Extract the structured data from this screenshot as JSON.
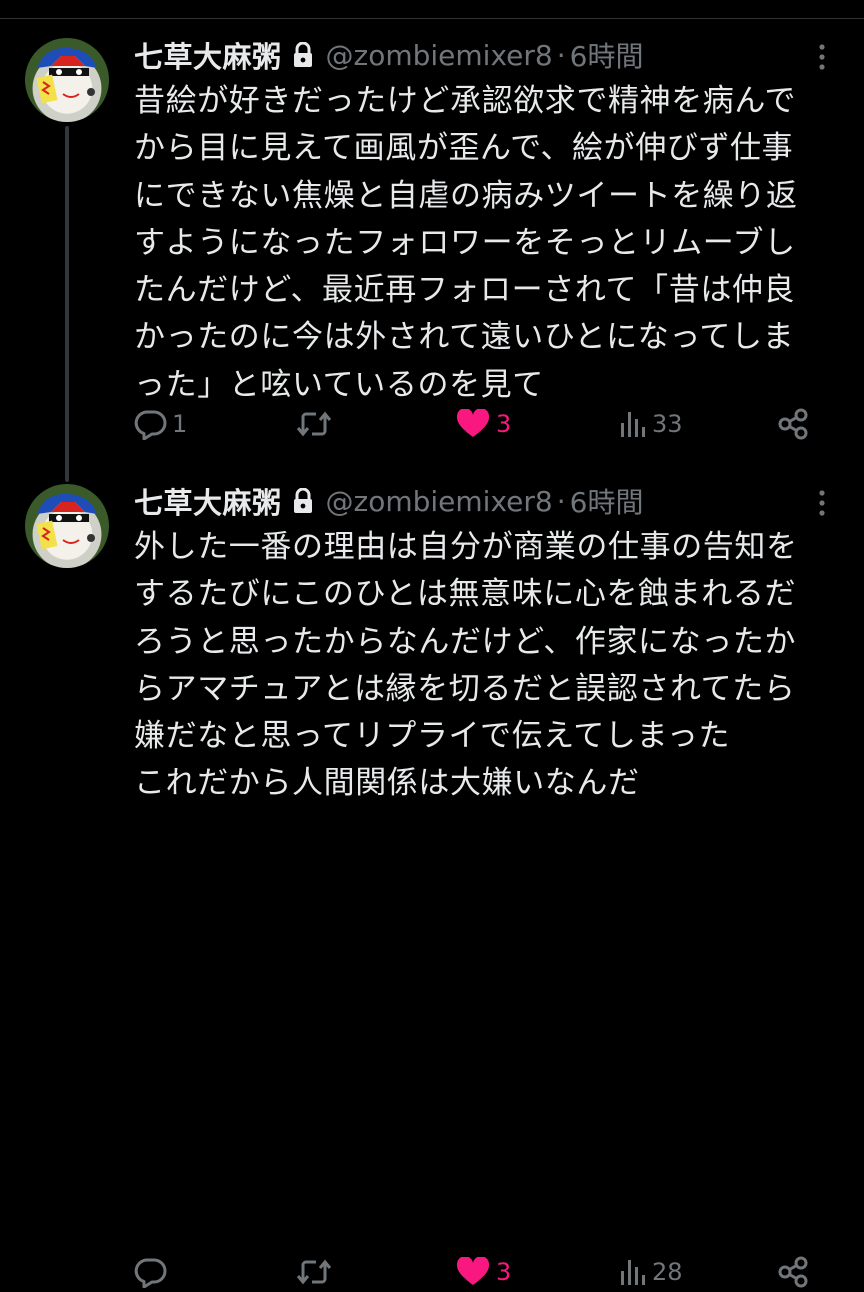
{
  "colors": {
    "background": "#000000",
    "text": "#e7e9ea",
    "muted": "#71767b",
    "like": "#f91880",
    "divider": "#2f3336"
  },
  "tweets": [
    {
      "display_name": "七草大麻粥",
      "handle": "@zombiemixer8",
      "separator": "·",
      "time": "6時間",
      "text": "昔絵が好きだったけど承認欲求で精神を病んで\nから目に見えて画風が歪んで、絵が伸びず仕事\nにできない焦燥と自虐の病みツイートを繰り返\nすようになったフォロワーをそっとリムーブし\nたんだけど、最近再フォローされて「昔は仲良\nかったのに今は外されて遠いひとになってしま\nった」と呟いているのを見て",
      "replies": "1",
      "retweets": "",
      "likes": "3",
      "views": "33",
      "liked": true
    },
    {
      "display_name": "七草大麻粥",
      "handle": "@zombiemixer8",
      "separator": "·",
      "time": "6時間",
      "text": "外した一番の理由は自分が商業の仕事の告知を\nするたびにこのひとは無意味に心を蝕まれるだ\nろうと思ったからなんだけど、作家になったか\nらアマチュアとは縁を切るだと誤認されてたら\n嫌だなと思ってリプライで伝えてしまった\nこれだから人間関係は大嫌いなんだ",
      "replies": "",
      "retweets": "",
      "likes": "3",
      "views": "28",
      "liked": true
    }
  ],
  "icons": {
    "lock": "lock-icon",
    "more": "more-icon",
    "reply": "reply-icon",
    "retweet": "retweet-icon",
    "like": "heart-icon",
    "views": "views-icon",
    "share": "share-icon"
  }
}
